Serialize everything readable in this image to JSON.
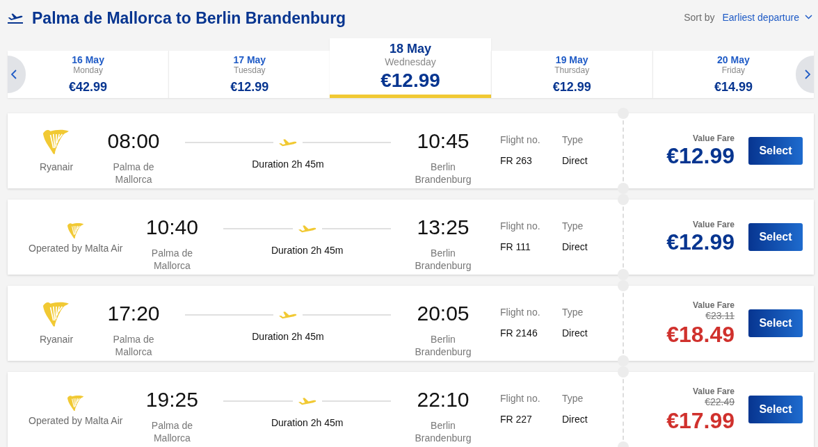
{
  "header": {
    "title": "Palma de Mallorca to Berlin Brandenburg",
    "sort_label": "Sort by",
    "sort_value": "Earliest departure"
  },
  "dates": [
    {
      "date": "16 May",
      "weekday": "Monday",
      "price": "€42.99",
      "selected": false
    },
    {
      "date": "17 May",
      "weekday": "Tuesday",
      "price": "€12.99",
      "selected": false
    },
    {
      "date": "18 May",
      "weekday": "Wednesday",
      "price": "€12.99",
      "selected": true
    },
    {
      "date": "19 May",
      "weekday": "Thursday",
      "price": "€12.99",
      "selected": false
    },
    {
      "date": "20 May",
      "weekday": "Friday",
      "price": "€14.99",
      "selected": false
    }
  ],
  "flights": [
    {
      "kind": "own",
      "airline": "Ryanair",
      "depart_time": "08:00",
      "depart_airport": "Palma de Mallorca",
      "duration": "Duration 2h 45m",
      "arrive_time": "10:45",
      "arrive_airport": "Berlin Brandenburg",
      "flight_no_label": "Flight no.",
      "flight_no": "FR 263",
      "type_label": "Type",
      "type": "Direct",
      "fare_label": "Value Fare",
      "price": "€12.99",
      "sale": false,
      "button": "Select"
    },
    {
      "kind": "partner",
      "airline": "Operated by Malta Air",
      "depart_time": "10:40",
      "depart_airport": "Palma de Mallorca",
      "duration": "Duration 2h 45m",
      "arrive_time": "13:25",
      "arrive_airport": "Berlin Brandenburg",
      "flight_no_label": "Flight no.",
      "flight_no": "FR 111",
      "type_label": "Type",
      "type": "Direct",
      "fare_label": "Value Fare",
      "price": "€12.99",
      "sale": false,
      "button": "Select"
    },
    {
      "kind": "own",
      "airline": "Ryanair",
      "depart_time": "17:20",
      "depart_airport": "Palma de Mallorca",
      "duration": "Duration 2h 45m",
      "arrive_time": "20:05",
      "arrive_airport": "Berlin Brandenburg",
      "flight_no_label": "Flight no.",
      "flight_no": "FR 2146",
      "type_label": "Type",
      "type": "Direct",
      "fare_label": "Value Fare",
      "old_price": "€23.11",
      "price": "€18.49",
      "sale": true,
      "button": "Select"
    },
    {
      "kind": "partner",
      "airline": "Operated by Malta Air",
      "depart_time": "19:25",
      "depart_airport": "Palma de Mallorca",
      "duration": "Duration 2h 45m",
      "arrive_time": "22:10",
      "arrive_airport": "Berlin Brandenburg",
      "flight_no_label": "Flight no.",
      "flight_no": "FR 227",
      "type_label": "Type",
      "type": "Direct",
      "fare_label": "Value Fare",
      "old_price": "€22.49",
      "price": "€17.99",
      "sale": true,
      "button": "Select"
    }
  ]
}
